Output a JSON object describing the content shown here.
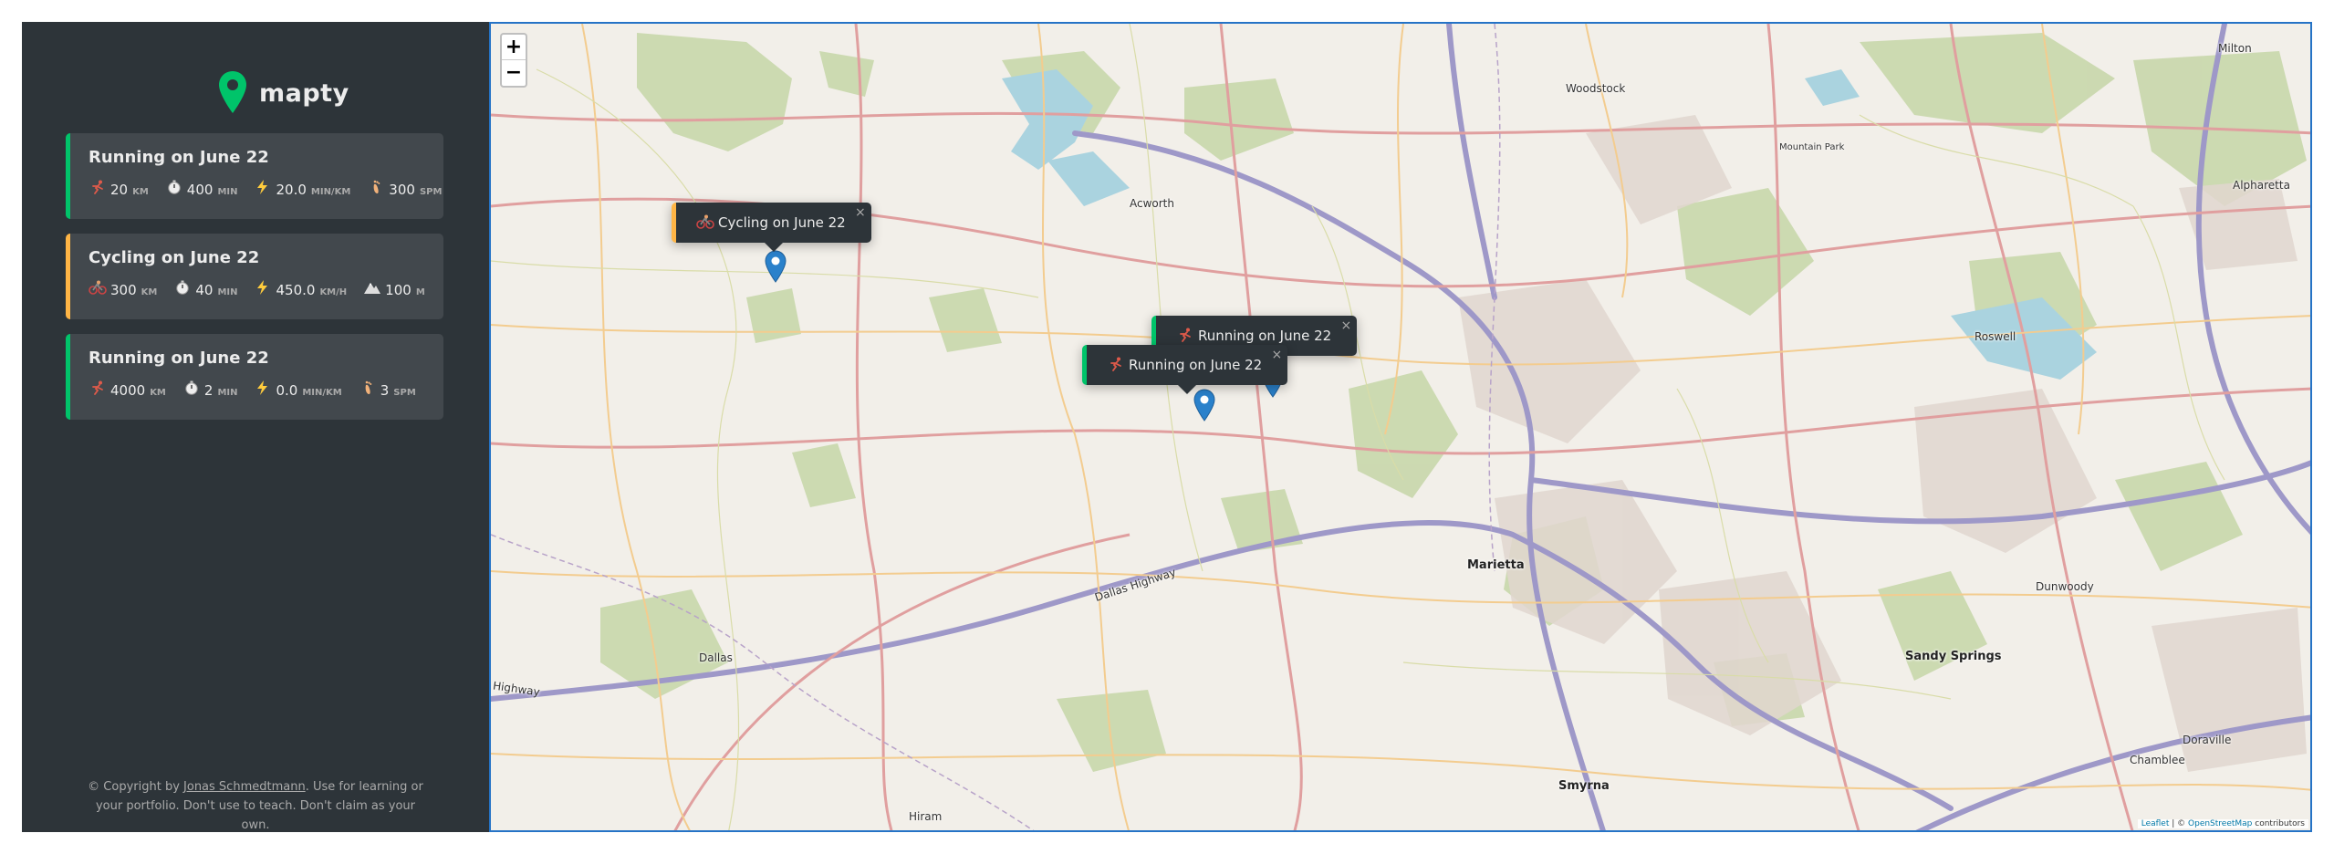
{
  "sidebar": {
    "logo_text": "mapty",
    "workouts": [
      {
        "type": "running",
        "title": "Running on June 22",
        "accent": "#00c46a",
        "details": [
          {
            "icon": "running-icon",
            "value": "20",
            "unit": "km"
          },
          {
            "icon": "stopwatch-icon",
            "value": "400",
            "unit": "min"
          },
          {
            "icon": "lightning-icon",
            "value": "20.0",
            "unit": "min/km"
          },
          {
            "icon": "footprint-icon",
            "value": "300",
            "unit": "spm"
          }
        ]
      },
      {
        "type": "cycling",
        "title": "Cycling on June 22",
        "accent": "#ffb545",
        "details": [
          {
            "icon": "cycling-icon",
            "value": "300",
            "unit": "km"
          },
          {
            "icon": "stopwatch-icon",
            "value": "40",
            "unit": "min"
          },
          {
            "icon": "lightning-icon",
            "value": "450.0",
            "unit": "km/h"
          },
          {
            "icon": "mountain-icon",
            "value": "100",
            "unit": "m"
          }
        ]
      },
      {
        "type": "running",
        "title": "Running on June 22",
        "accent": "#00c46a",
        "details": [
          {
            "icon": "running-icon",
            "value": "4000",
            "unit": "km"
          },
          {
            "icon": "stopwatch-icon",
            "value": "2",
            "unit": "min"
          },
          {
            "icon": "lightning-icon",
            "value": "0.0",
            "unit": "min/km"
          },
          {
            "icon": "footprint-icon",
            "value": "3",
            "unit": "spm"
          }
        ]
      }
    ],
    "copyright_prefix": "© Copyright by ",
    "copyright_author": "Jonas Schmedtmann",
    "copyright_suffix": ". Use for learning or your portfolio. Don't use to teach. Don't claim as your own."
  },
  "map": {
    "zoom_in": "+",
    "zoom_out": "−",
    "popups": [
      {
        "text": "Cycling on June 22",
        "icon": "cycling-icon",
        "accent": "#ffb545",
        "close": "×"
      },
      {
        "text": "Running on June 22",
        "icon": "running-icon",
        "accent": "#00c46a",
        "close": "×"
      },
      {
        "text": "Running on June 22",
        "icon": "running-icon",
        "accent": "#00c46a",
        "close": "×"
      }
    ],
    "places": [
      "Woodstock",
      "Milton",
      "Mountain Park",
      "Alpharetta",
      "Acworth",
      "Roswell",
      "Marietta",
      "Dunwoody",
      "Sandy Springs",
      "Dallas",
      "Smyrna",
      "Doraville",
      "Chamblee",
      "Dallas Highway",
      "Highway",
      "Hiram"
    ],
    "attribution_leaflet": "Leaflet",
    "attribution_sep": " | © ",
    "attribution_osm": "OpenStreetMap",
    "attribution_suffix": " contributors"
  }
}
